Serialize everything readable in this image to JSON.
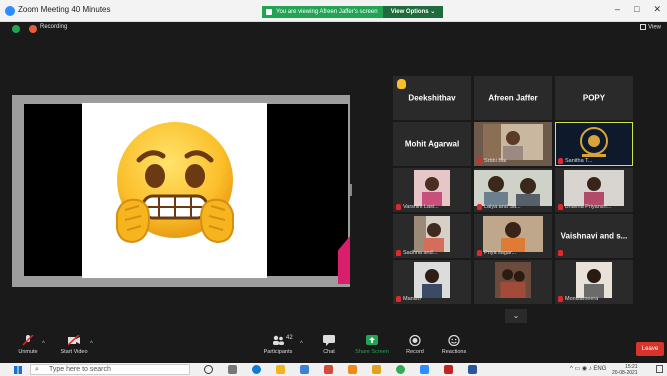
{
  "window": {
    "title": "Zoom Meeting 40 Minutes",
    "controls": [
      "–",
      "□",
      "✕"
    ]
  },
  "banner": {
    "text": "You are viewing Afreen Jaffer's screen",
    "view_options": "View Options ⌄"
  },
  "status": {
    "recording": "Recording",
    "view": "View"
  },
  "colors": {
    "accent_green": "#23a455",
    "leave_red": "#d9342b",
    "highlight": "#c9e64a",
    "zoom_blue": "#2d8cff"
  },
  "gallery": {
    "name_tiles": [
      {
        "name": "Deekshithav",
        "icon": "raised-hand-icon"
      },
      {
        "name": "Afreen Jaffer"
      },
      {
        "name": "POPY"
      },
      {
        "name": "Mohit Agarwal"
      },
      {
        "name": "Vaishnavi and s..."
      }
    ],
    "video_tiles": [
      {
        "label": "Srbbi Bai"
      },
      {
        "label": "Sanitha T..."
      },
      {
        "label": "Varshini Lasi..."
      },
      {
        "label": "Laiya and Sa..."
      },
      {
        "label": "Bhavna Priyansh..."
      },
      {
        "label": "Sadhna and..."
      },
      {
        "label": "Priya sagar..."
      },
      {
        "label": "Manish"
      },
      {
        "label": "Monisameera"
      }
    ],
    "more": "⌄"
  },
  "toolbar": {
    "unmute": "Unmute",
    "start_video": "Start Video",
    "participants": "Participants",
    "participants_count": "42",
    "chat": "Chat",
    "share_screen": "Share Screen",
    "record": "Record",
    "reactions": "Reactions",
    "leave": "Leave"
  },
  "taskbar": {
    "search_placeholder": "Type here to search",
    "time": "15:21",
    "date": "20-08-2021"
  }
}
